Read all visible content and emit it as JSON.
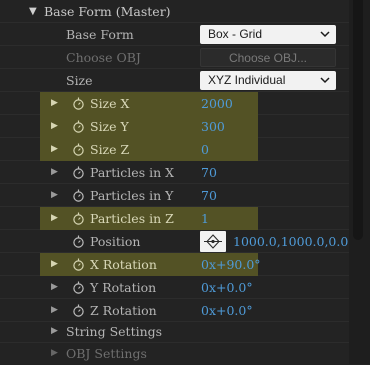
{
  "section": {
    "title": "Base Form (Master)"
  },
  "rows": {
    "base_form": {
      "label": "Base Form",
      "value": "Box - Grid"
    },
    "choose_obj": {
      "label": "Choose OBJ",
      "value": "Choose OBJ..."
    },
    "size": {
      "label": "Size",
      "value": "XYZ Individual"
    },
    "size_x": {
      "label": "Size X",
      "value": "2000"
    },
    "size_y": {
      "label": "Size Y",
      "value": "300"
    },
    "size_z": {
      "label": "Size Z",
      "value": "0"
    },
    "particles_x": {
      "label": "Particles in X",
      "value": "70"
    },
    "particles_y": {
      "label": "Particles in Y",
      "value": "70"
    },
    "particles_z": {
      "label": "Particles in Z",
      "value": "1"
    },
    "position": {
      "label": "Position",
      "value": "1000.0,1000.0,0.0"
    },
    "x_rotation": {
      "label": "X Rotation",
      "value": "0x+90.0°"
    },
    "y_rotation": {
      "label": "Y Rotation",
      "value": "0x+0.0°"
    },
    "z_rotation": {
      "label": "Z Rotation",
      "value": "0x+0.0°"
    },
    "string_settings": {
      "label": "String Settings"
    },
    "obj_settings": {
      "label": "OBJ Settings"
    }
  },
  "colors": {
    "highlight": "#535225",
    "value_blue": "#4f9bd8",
    "panel_bg": "#232323"
  },
  "icons": {
    "collapse": "triangle-down-icon",
    "expand": "triangle-right-icon",
    "keyframe": "stopwatch-icon",
    "dropdown": "chevron-down-icon",
    "point": "crosshair-icon"
  }
}
